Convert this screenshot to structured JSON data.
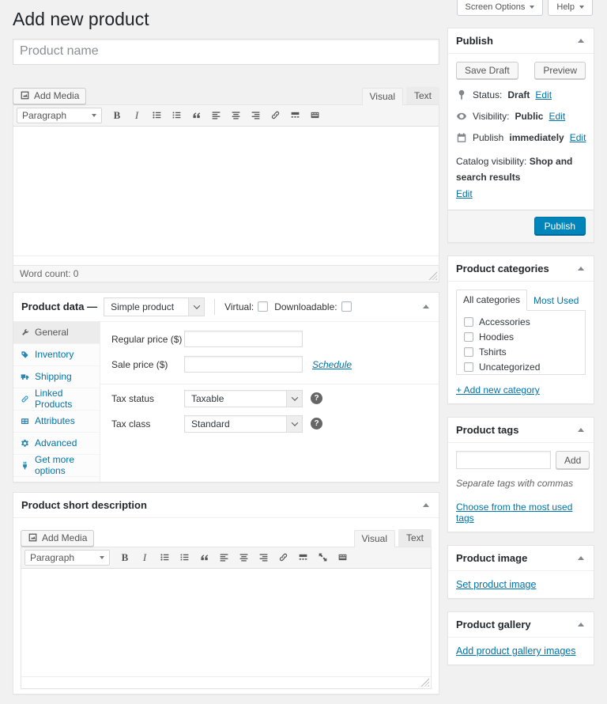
{
  "page": {
    "title": "Add new product"
  },
  "screen_tabs": {
    "screen_options": "Screen Options",
    "help": "Help"
  },
  "product_name": {
    "placeholder": "Product name"
  },
  "toolbar_glyphs": {
    "bold": "B",
    "italic": "I"
  },
  "main_editor": {
    "add_media": "Add Media",
    "visual_tab": "Visual",
    "text_tab": "Text",
    "paragraph": "Paragraph",
    "word_count": "Word count: 0"
  },
  "product_data": {
    "title": "Product data —",
    "type_value": "Simple product",
    "virtual_label": "Virtual:",
    "downloadable_label": "Downloadable:",
    "tabs": [
      {
        "label": "General",
        "icon": "wrench-icon"
      },
      {
        "label": "Inventory",
        "icon": "inventory-tag-icon"
      },
      {
        "label": "Shipping",
        "icon": "truck-icon"
      },
      {
        "label": "Linked Products",
        "icon": "link-icon"
      },
      {
        "label": "Attributes",
        "icon": "attributes-icon"
      },
      {
        "label": "Advanced",
        "icon": "gear-icon"
      },
      {
        "label": "Get more options",
        "icon": "plugin-icon"
      }
    ],
    "general": {
      "regular_price_label": "Regular price ($)",
      "sale_price_label": "Sale price ($)",
      "schedule_link": "Schedule",
      "tax_status_label": "Tax status",
      "tax_status_value": "Taxable",
      "tax_class_label": "Tax class",
      "tax_class_value": "Standard",
      "help_glyph": "?"
    }
  },
  "short_description": {
    "title": "Product short description",
    "add_media": "Add Media",
    "visual_tab": "Visual",
    "text_tab": "Text",
    "paragraph": "Paragraph"
  },
  "publish_box": {
    "title": "Publish",
    "save_draft": "Save Draft",
    "preview": "Preview",
    "rows": [
      {
        "icon": "pin-icon",
        "label": "Status:",
        "value": "Draft",
        "edit": "Edit"
      },
      {
        "icon": "eye-icon",
        "label": "Visibility:",
        "value": "Public",
        "edit": "Edit"
      },
      {
        "icon": "calendar-icon",
        "label": "Publish",
        "value": "immediately",
        "edit": "Edit"
      }
    ],
    "catalog": {
      "label": "Catalog visibility:",
      "value": "Shop and search results",
      "edit": "Edit"
    },
    "publish_button": "Publish"
  },
  "categories_box": {
    "title": "Product categories",
    "tab_all": "All categories",
    "tab_most_used": "Most Used",
    "items": [
      "Accessories",
      "Hoodies",
      "Tshirts",
      "Uncategorized"
    ],
    "add_new_link": "+ Add new category"
  },
  "tags_box": {
    "title": "Product tags",
    "add_button": "Add",
    "hint": "Separate tags with commas",
    "choose_link": "Choose from the most used tags"
  },
  "image_box": {
    "title": "Product image",
    "set_link": "Set product image"
  },
  "gallery_box": {
    "title": "Product gallery",
    "add_link": "Add product gallery images"
  },
  "colors": {
    "link": "#0073aa",
    "primary_button": "#0085ba",
    "page_bg": "#f1f1f1",
    "box_border": "#e5e5e5"
  }
}
